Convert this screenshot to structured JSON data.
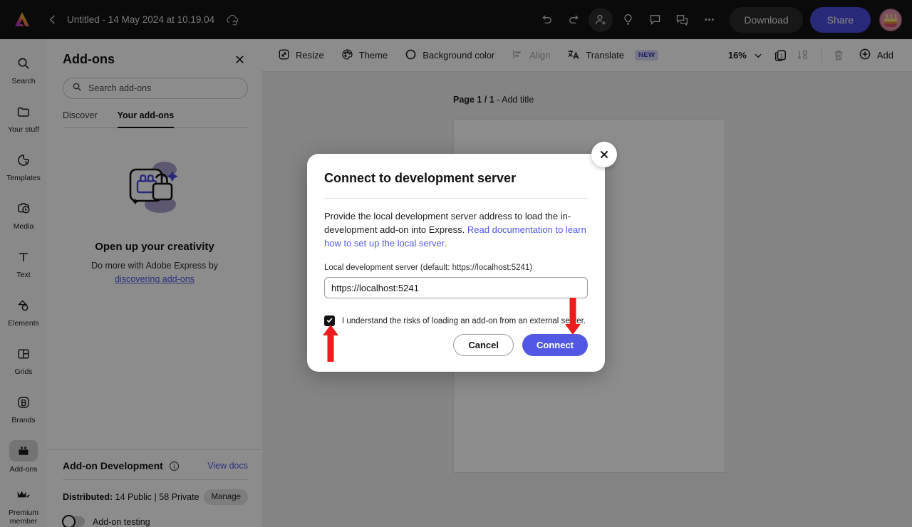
{
  "header": {
    "logo_icon": "adobe-express-logo",
    "back_icon": "chevron-left-icon",
    "doc_title": "Untitled - 14 May 2024 at 10.19.04",
    "cloud_icon": "cloud-sync-icon",
    "undo_icon": "undo-icon",
    "redo_icon": "redo-icon",
    "invite_icon": "add-person-icon",
    "ideas_icon": "lightbulb-icon",
    "comment_icon": "comment-icon",
    "chat_icon": "chat-icon",
    "more_icon": "more-horizontal-icon",
    "download_label": "Download",
    "share_label": "Share",
    "avatar_name": "user-avatar",
    "share_color": "#4b4bdd"
  },
  "rail": {
    "items": [
      {
        "label": "Search",
        "icon": "search-icon",
        "active": false
      },
      {
        "label": "Your stuff",
        "icon": "folder-icon",
        "active": false
      },
      {
        "label": "Templates",
        "icon": "templates-icon",
        "active": false
      },
      {
        "label": "Media",
        "icon": "media-icon",
        "active": false
      },
      {
        "label": "Text",
        "icon": "text-icon",
        "active": false
      },
      {
        "label": "Elements",
        "icon": "elements-icon",
        "active": false
      },
      {
        "label": "Grids",
        "icon": "grids-icon",
        "active": false
      },
      {
        "label": "Brands",
        "icon": "brands-icon",
        "active": false
      },
      {
        "label": "Add-ons",
        "icon": "addons-icon",
        "active": true
      },
      {
        "label": "Premium member",
        "icon": "crown-icon",
        "active": false
      }
    ]
  },
  "panel": {
    "title": "Add-ons",
    "close_icon": "close-icon",
    "search": {
      "icon": "search-icon",
      "placeholder": "Search add-ons",
      "value": ""
    },
    "tabs": [
      {
        "label": "Discover",
        "active": false
      },
      {
        "label": "Your add-ons",
        "active": true
      }
    ],
    "empty_state": {
      "illustration": "addon-unlock-illustration",
      "heading": "Open up your creativity",
      "text": "Do more with Adobe Express by",
      "link": "discovering add-ons",
      "link_color": "#5258e4"
    },
    "dev_section": {
      "title": "Add-on Development",
      "info_icon": "info-icon",
      "docs_link": "View docs",
      "distributed_label": "Distributed:",
      "distributed_value": "14 Public | 58 Private",
      "manage_label": "Manage",
      "toggle_label": "Add-on testing",
      "toggle_on": false
    }
  },
  "toolbar": {
    "resize": {
      "label": "Resize",
      "icon": "resize-icon",
      "disabled": false
    },
    "theme": {
      "label": "Theme",
      "icon": "palette-icon",
      "disabled": false
    },
    "background": {
      "label": "Background color",
      "icon": "circle-icon",
      "disabled": false
    },
    "align": {
      "label": "Align",
      "icon": "align-icon",
      "disabled": true
    },
    "translate": {
      "label": "Translate",
      "icon": "translate-icon",
      "badge": "NEW",
      "disabled": false
    },
    "zoom_value": "16%",
    "zoom_chevron_icon": "chevron-down-icon",
    "pages_icon": "pages-count-icon",
    "arrange_icon": "arrange-icon",
    "delete_icon": "trash-icon",
    "add_icon": "plus-circle-icon",
    "add_label": "Add"
  },
  "canvas": {
    "page_label_bold": "Page 1 / 1",
    "page_label_rest": "- Add title"
  },
  "modal": {
    "title": "Connect to development server",
    "close_icon": "close-icon",
    "body_text": "Provide the local development server address to load the in-development add-on into Express. ",
    "body_link": "Read documentation to learn how to set up the local server.",
    "field_label": "Local development server (default: https://localhost:5241)",
    "field_value": "https://localhost:5241",
    "field_placeholder": "https://localhost:5241",
    "checkbox_label": "I understand the risks of loading an add-on from an external server.",
    "checkbox_checked": true,
    "check_icon": "checkmark-icon",
    "cancel_label": "Cancel",
    "connect_label": "Connect",
    "connect_color": "#5258e4"
  },
  "annotations": {
    "arrow_color": "#ee1c1c",
    "arrow_up_target": "risk-acknowledgement-checkbox",
    "arrow_down_target": "connect-button"
  }
}
